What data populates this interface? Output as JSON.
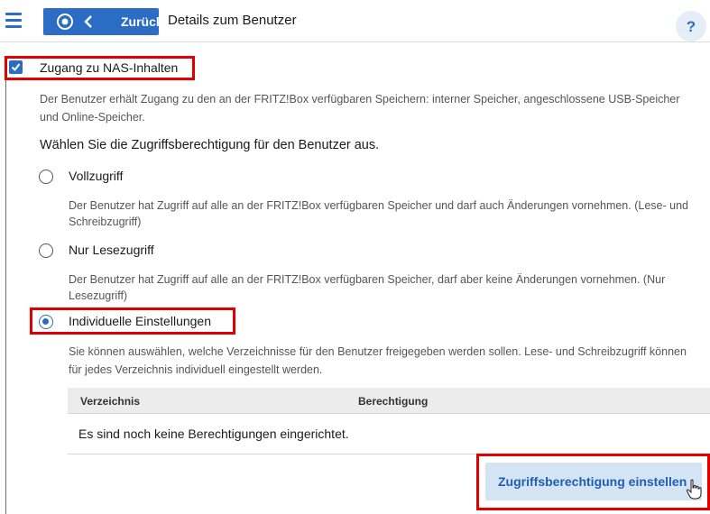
{
  "header": {
    "back_label": "Zurück",
    "title": "Details zum Benutzer",
    "help_label": "?"
  },
  "nas_access": {
    "label": "Zugang zu NAS-Inhalten",
    "checked": true,
    "description_line1": "Der Benutzer erhält Zugang zu den an der FRITZ!Box verfügbaren Speichern: interner Speicher, angeschlossene USB-Speicher",
    "description_line2": "und Online-Speicher."
  },
  "permission": {
    "heading": "Wählen Sie die Zugriffsberechtigung für den Benutzer aus.",
    "options": [
      {
        "label": "Vollzugriff",
        "selected": false,
        "line1": "Der Benutzer hat Zugriff auf alle an der FRITZ!Box verfügbaren Speicher und darf auch Änderungen vornehmen. (Lese- und",
        "line2": "Schreibzugriff)"
      },
      {
        "label": "Nur Lesezugriff",
        "selected": false,
        "line1": "Der Benutzer hat Zugriff auf alle an der FRITZ!Box verfügbaren Speicher, darf aber keine Änderungen vornehmen. (Nur",
        "line2": "Lesezugriff)"
      },
      {
        "label": "Individuelle Einstellungen",
        "selected": true,
        "line1": "Sie können auswählen, welche Verzeichnisse für den Benutzer freigegeben werden sollen. Lese- und Schreibzugriff können",
        "line2": "für jedes Verzeichnis individuell eingestellt werden."
      }
    ]
  },
  "table": {
    "columns": [
      "Verzeichnis",
      "Berechtigung"
    ],
    "empty_message": "Es sind noch keine Berechtigungen eingerichtet."
  },
  "action_button": "Zugriffsberechtigung einstellen",
  "colors": {
    "accent": "#2b6cc4",
    "highlight": "#e00000",
    "button_bg": "#d5e4f5"
  }
}
